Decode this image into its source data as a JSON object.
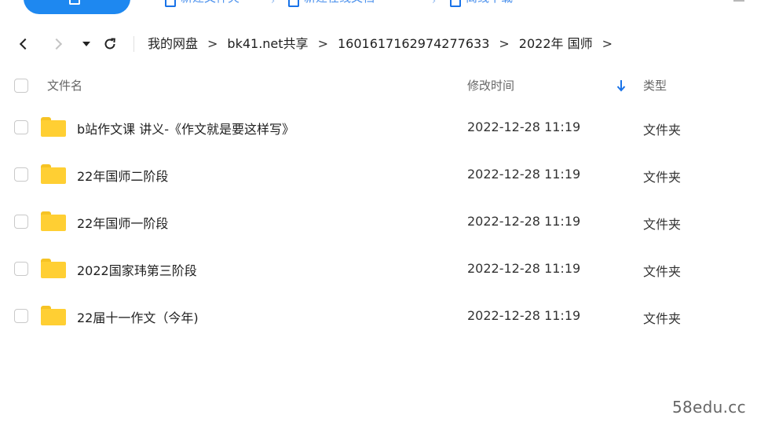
{
  "toolbar": {
    "upload_label": "上传",
    "items": [
      "新建文件夹",
      "新建在线文档",
      "离线下载"
    ]
  },
  "nav": {
    "breadcrumb": [
      "我的网盘",
      "bk41.net共享",
      "1601617162974277633",
      "2022年 国师"
    ],
    "separator": ">"
  },
  "header": {
    "name": "文件名",
    "modified": "修改时间",
    "type": "类型",
    "sort_icon": "sort-down-arrow-icon",
    "sort_color": "#1a73e8"
  },
  "files": [
    {
      "name": "b站作文课 讲义-《作文就是要这样写》",
      "modified": "2022-12-28 11:19",
      "type": "文件夹"
    },
    {
      "name": "22年国师二阶段",
      "modified": "2022-12-28 11:19",
      "type": "文件夹"
    },
    {
      "name": "22年国师一阶段",
      "modified": "2022-12-28 11:19",
      "type": "文件夹"
    },
    {
      "name": "2022国家玮第三阶段",
      "modified": "2022-12-28 11:19",
      "type": "文件夹"
    },
    {
      "name": "22届十一作文（今年)",
      "modified": "2022-12-28 11:19",
      "type": "文件夹"
    }
  ],
  "colors": {
    "accent": "#1e88f0",
    "folder": "#ffcf33"
  },
  "watermark": "58edu.cc"
}
